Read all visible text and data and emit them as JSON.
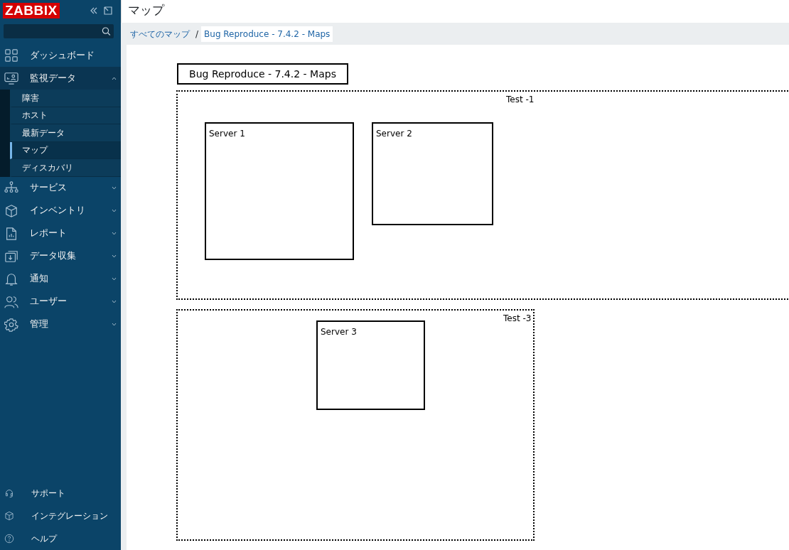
{
  "sidebar": {
    "logo": "ZABBIX",
    "items": [
      {
        "kind": "link",
        "label": "ダッシュボード",
        "expanded": false
      },
      {
        "kind": "group",
        "label": "監視データ",
        "expanded": true,
        "children": [
          {
            "label": "障害",
            "selected": false
          },
          {
            "label": "ホスト",
            "selected": false
          },
          {
            "label": "最新データ",
            "selected": false
          },
          {
            "label": "マップ",
            "selected": true
          },
          {
            "label": "ディスカバリ",
            "selected": false
          }
        ]
      },
      {
        "kind": "group",
        "label": "サービス",
        "expanded": false
      },
      {
        "kind": "group",
        "label": "インベントリ",
        "expanded": false
      },
      {
        "kind": "group",
        "label": "レポート",
        "expanded": false
      },
      {
        "kind": "group",
        "label": "データ収集",
        "expanded": false
      },
      {
        "kind": "group",
        "label": "通知",
        "expanded": false
      },
      {
        "kind": "group",
        "label": "ユーザー",
        "expanded": false
      },
      {
        "kind": "group",
        "label": "管理",
        "expanded": false
      }
    ],
    "footer": [
      {
        "label": "サポート"
      },
      {
        "label": "インテグレーション"
      },
      {
        "label": "ヘルプ"
      }
    ]
  },
  "page_title": "マップ",
  "breadcrumb": {
    "separator": "/",
    "items": [
      {
        "label": "すべてのマップ",
        "selected": false
      },
      {
        "label": "Bug Reproduce - 7.4.2 - Maps",
        "selected": true
      }
    ]
  },
  "map": {
    "shapes": [
      {
        "kind": "title",
        "label": "Bug Reproduce - 7.4.2 - Maps"
      },
      {
        "kind": "container",
        "label": "Test -1"
      },
      {
        "kind": "host",
        "label": "Server 1"
      },
      {
        "kind": "host",
        "label": "Server 2"
      },
      {
        "kind": "container",
        "label": "Test -3"
      },
      {
        "kind": "host",
        "label": "Server 3"
      }
    ]
  }
}
